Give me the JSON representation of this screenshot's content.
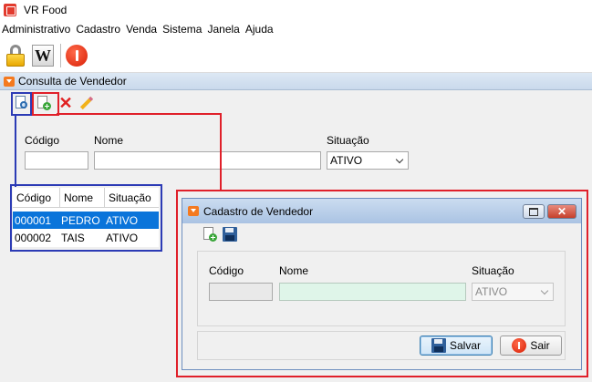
{
  "window": {
    "title": "VR Food",
    "app_icon": "vr-food-app-icon"
  },
  "menu": {
    "items": [
      "Administrativo",
      "Cadastro",
      "Venda",
      "Sistema",
      "Janela",
      "Ajuda"
    ]
  },
  "toolbar": {
    "icons": [
      "lock-icon",
      "w-icon",
      "power-icon"
    ],
    "w_letter": "W"
  },
  "consulta": {
    "title": "Consulta de Vendedor",
    "tools": [
      "search-icon",
      "new-document-icon",
      "delete-icon",
      "edit-pencil-icon"
    ],
    "filters": {
      "codigo_label": "Código",
      "codigo_value": "",
      "nome_label": "Nome",
      "nome_value": "",
      "situacao_label": "Situação",
      "situacao_value": "ATIVO"
    },
    "grid": {
      "columns": [
        "Código",
        "Nome",
        "Situação"
      ],
      "rows": [
        {
          "codigo": "000001",
          "nome": "PEDRO",
          "situacao": "ATIVO",
          "selected": true
        },
        {
          "codigo": "000002",
          "nome": "TAIS",
          "situacao": "ATIVO",
          "selected": false
        }
      ]
    }
  },
  "dialog": {
    "title": "Cadastro de Vendedor",
    "close_glyph": "✕",
    "tools": [
      "new-document-icon",
      "save-icon"
    ],
    "fields": {
      "codigo_label": "Código",
      "codigo_value": "",
      "nome_label": "Nome",
      "nome_value": "",
      "situacao_label": "Situação",
      "situacao_value": "ATIVO"
    },
    "buttons": {
      "salvar": "Salvar",
      "sair": "Sair"
    }
  },
  "colors": {
    "highlight_blue": "#2c3bb5",
    "highlight_red": "#e0202a",
    "selected_row": "#0a74da",
    "name_field_bg": "#dff5e9"
  }
}
